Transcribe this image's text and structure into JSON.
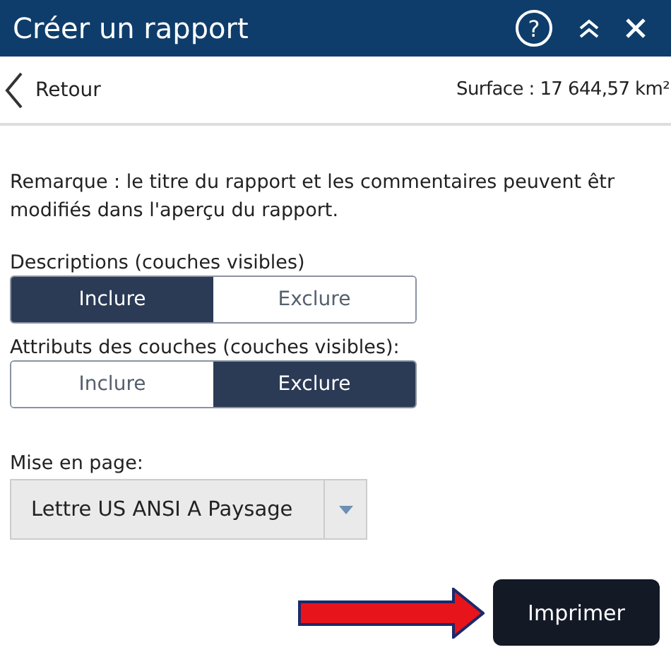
{
  "header": {
    "title": "Créer un rapport",
    "buttons": [
      {
        "kind": "help",
        "label": "?"
      },
      {
        "kind": "collapse"
      },
      {
        "kind": "close"
      }
    ]
  },
  "nav": {
    "back": "Retour",
    "area": "Surface : 17 644,57 km²"
  },
  "remark_lines": [
    "Remarque : le titre du rapport et les commentaires peuvent êtr",
    "modifiés dans l'aperçu du rapport."
  ],
  "toggles": [
    {
      "label": "Descriptions (couches visibles)",
      "options": [
        {
          "label": "Inclure",
          "selected": true
        },
        {
          "label": "Exclure",
          "selected": false
        }
      ]
    },
    {
      "label": "Attributs des couches (couches visibles):",
      "options": [
        {
          "label": "Inclure",
          "selected": false
        },
        {
          "label": "Exclure",
          "selected": true
        }
      ]
    }
  ],
  "layout": {
    "label": "Mise en page:",
    "value": "Lettre US ANSI A Paysage"
  },
  "print_button": "Imprimer"
}
